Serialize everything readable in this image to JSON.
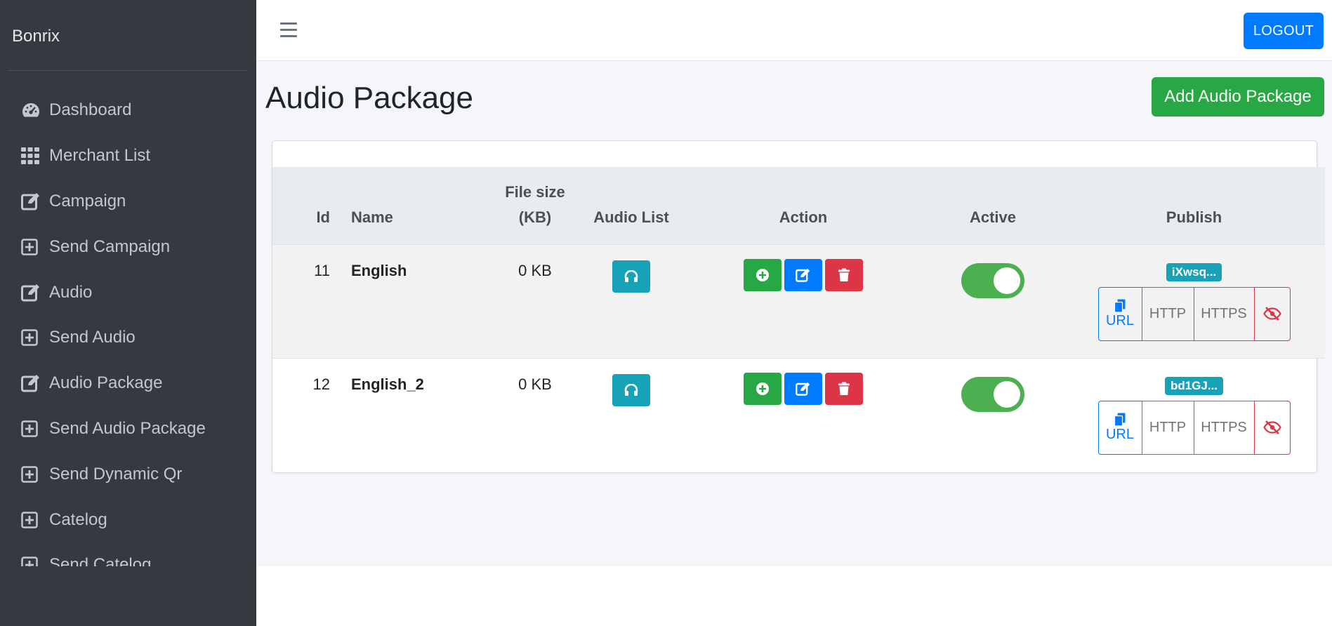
{
  "brand": "Bonrix",
  "sidebar": {
    "items": [
      {
        "label": "Dashboard",
        "icon": "tachometer-icon"
      },
      {
        "label": "Merchant List",
        "icon": "grid-icon"
      },
      {
        "label": "Campaign",
        "icon": "edit-icon"
      },
      {
        "label": "Send Campaign",
        "icon": "plus-square-icon"
      },
      {
        "label": "Audio",
        "icon": "edit-icon"
      },
      {
        "label": "Send Audio",
        "icon": "plus-square-icon"
      },
      {
        "label": "Audio Package",
        "icon": "edit-icon"
      },
      {
        "label": "Send Audio Package",
        "icon": "plus-square-icon"
      },
      {
        "label": "Send Dynamic Qr",
        "icon": "plus-square-icon"
      },
      {
        "label": "Catelog",
        "icon": "plus-square-icon"
      },
      {
        "label": "Send Catelog",
        "icon": "plus-square-icon"
      }
    ]
  },
  "header": {
    "logout_label": "LOGOUT"
  },
  "main": {
    "title": "Audio Package",
    "add_button": "Add Audio Package",
    "table": {
      "columns": {
        "id": "Id",
        "name": "Name",
        "file_size_line1": "File size",
        "file_size_line2": "(KB)",
        "audio_list": "Audio List",
        "action": "Action",
        "active": "Active",
        "publish": "Publish"
      },
      "rows": [
        {
          "id": "11",
          "name": "English",
          "file_size": "0 KB",
          "active": true,
          "publish_code": "iXwsq...",
          "url_label": "URL",
          "http_label": "HTTP",
          "https_label": "HTTPS"
        },
        {
          "id": "12",
          "name": "English_2",
          "file_size": "0 KB",
          "active": true,
          "publish_code": "bd1GJ...",
          "url_label": "URL",
          "http_label": "HTTP",
          "https_label": "HTTPS"
        }
      ]
    }
  },
  "colors": {
    "sidebar_bg": "#343a40",
    "primary": "#007bff",
    "success": "#28a745",
    "danger": "#dc3545",
    "info": "#17a2b8",
    "toggle_on": "#4caf50"
  }
}
